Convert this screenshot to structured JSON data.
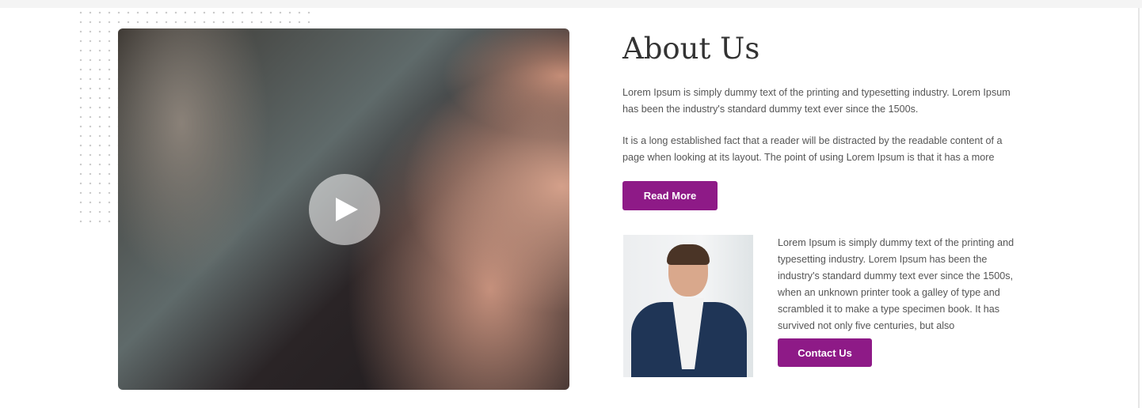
{
  "about": {
    "title": "About Us",
    "paragraph1": "Lorem Ipsum is simply dummy text of the printing and typesetting industry. Lorem Ipsum has been the industry's standard dummy text ever since the 1500s.",
    "paragraph2": "It is a long established fact that a reader will be distracted by the readable content of a page when looking at its layout. The point of using Lorem Ipsum is that it has a more",
    "read_more_label": "Read More"
  },
  "profile": {
    "text": "Lorem Ipsum is simply dummy text of the printing and typesetting industry. Lorem Ipsum has been the industry's standard dummy text ever since the 1500s, when an unknown printer took a galley of type and scrambled it to make a type specimen book. It has survived not only five centuries, but also",
    "contact_label": "Contact Us"
  },
  "colors": {
    "accent": "#8e1a87"
  },
  "media": {
    "play_icon": "play-icon"
  }
}
